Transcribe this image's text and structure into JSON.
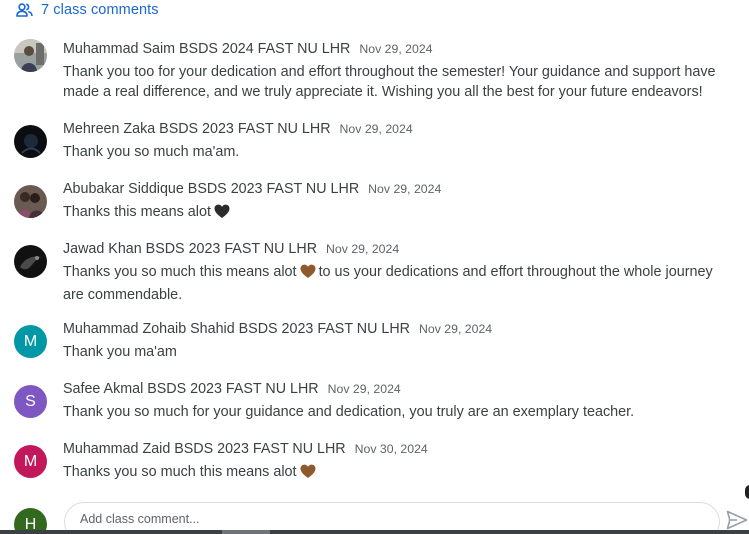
{
  "header": {
    "label": "7 class comments",
    "icon": "people-icon",
    "color": "#1967d2"
  },
  "comments": [
    {
      "author": "Muhammad Saim BSDS 2024 FAST NU LHR",
      "date": "Nov 29, 2024",
      "text": "Thank you too for your dedication and effort throughout the semester! Your guidance and support have made a real difference, and we truly appreciate it. Wishing you all the best for your future endeavors!",
      "avatar": {
        "type": "photo",
        "icon": "profile-photo"
      }
    },
    {
      "author": "Mehreen Zaka BSDS 2023 FAST NU LHR",
      "date": "Nov 29, 2024",
      "text": "Thank you so much ma'am.",
      "avatar": {
        "type": "photo",
        "icon": "profile-photo"
      }
    },
    {
      "author": "Abubakar Siddique BSDS 2023 FAST NU LHR",
      "date": "Nov 29, 2024",
      "text_before": "Thanks this means alot",
      "text_after": "",
      "emoji": "black-heart",
      "avatar": {
        "type": "photo",
        "icon": "profile-photo"
      }
    },
    {
      "author": "Jawad Khan BSDS 2023 FAST NU LHR",
      "date": "Nov 29, 2024",
      "text_before": "Thanks you so much this means alot",
      "text_after": "to us your dedications and effort throughout the whole journey are commendable.",
      "emoji": "brown-heart",
      "avatar": {
        "type": "photo",
        "icon": "profile-photo"
      }
    },
    {
      "author": "Muhammad Zohaib Shahid BSDS 2023 FAST NU LHR",
      "date": "Nov 29, 2024",
      "text": "Thank you ma'am",
      "avatar": {
        "type": "letter",
        "letter": "M",
        "color": "#0097a7"
      }
    },
    {
      "author": "Safee Akmal BSDS 2023 FAST NU LHR",
      "date": "Nov 29, 2024",
      "text": "Thank you so much for your guidance and dedication, you truly are an exemplary teacher.",
      "avatar": {
        "type": "letter",
        "letter": "S",
        "color": "#7e57c2"
      }
    },
    {
      "author": "Muhammad Zaid BSDS 2023 FAST NU LHR",
      "date": "Nov 30, 2024",
      "text_before": "Thanks you so much this means alot",
      "text_after": "",
      "emoji": "brown-heart",
      "avatar": {
        "type": "letter",
        "letter": "M",
        "color": "#c2185b"
      }
    }
  ],
  "composer": {
    "avatar_letter": "H",
    "avatar_color": "#33691e",
    "placeholder": "Add class comment...",
    "send_icon": "send-icon"
  }
}
